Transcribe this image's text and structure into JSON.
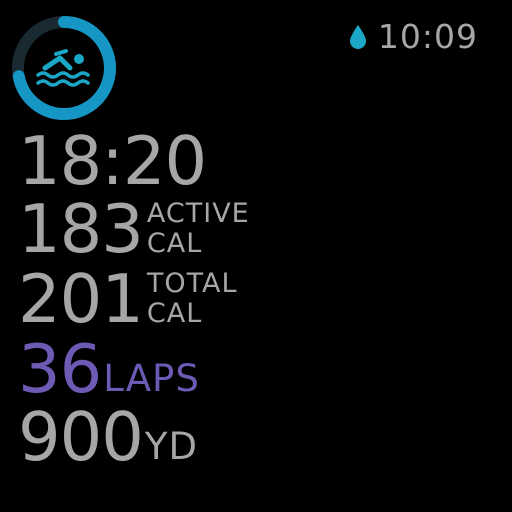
{
  "status": {
    "time": "10:09",
    "water_lock_icon": "water-drop-icon",
    "water_lock_color": "#1ba8c6"
  },
  "workout": {
    "icon": "swimmer-icon",
    "ring_color": "#1696c4",
    "ring_track_color": "#1a2a33",
    "ring_progress": 0.72
  },
  "metrics": {
    "duration": {
      "value": "18:20"
    },
    "active_calories": {
      "value": "183",
      "unit_line1": "ACTIVE",
      "unit_line2": "CAL"
    },
    "total_calories": {
      "value": "201",
      "unit_line1": "TOTAL",
      "unit_line2": "CAL"
    },
    "laps": {
      "value": "36",
      "unit": "LAPS",
      "color": "#6d5ab4"
    },
    "distance": {
      "value": "900",
      "unit": "YD"
    }
  },
  "colors": {
    "text": "#a6a6a6",
    "background": "#000000"
  }
}
